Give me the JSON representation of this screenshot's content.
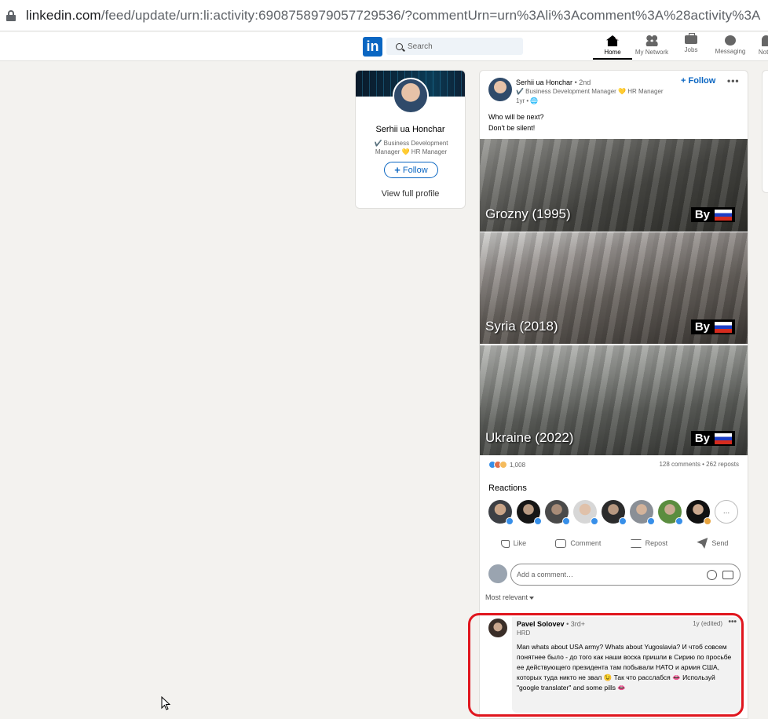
{
  "browser": {
    "url_host": "linkedin.com",
    "url_path": "/feed/update/urn:li:activity:6908758979057729536/?commentUrn=urn%3Ali%3Acomment%3A%28activity%3A"
  },
  "nav": {
    "logo": "in",
    "search_placeholder": "Search",
    "items": [
      {
        "label": "Home",
        "icon": "home-icon",
        "active": true
      },
      {
        "label": "My Network",
        "icon": "network-icon"
      },
      {
        "label": "Jobs",
        "icon": "jobs-icon"
      },
      {
        "label": "Messaging",
        "icon": "messaging-icon"
      },
      {
        "label": "Notifi",
        "icon": "notifications-icon"
      }
    ]
  },
  "profile_card": {
    "name": "Serhii ua Honchar",
    "title": "✔️ Business Development Manager 💛 HR Manager",
    "follow_label": "Follow",
    "view_profile_label": "View full profile"
  },
  "post": {
    "author": "Serhii ua Honchar",
    "degree": "• 2nd",
    "author_title": "✔️ Business Development Manager 💛 HR Manager",
    "time": "1yr •",
    "follow_label": "Follow",
    "text_line1": "Who will be next?",
    "text_line2": "Don't be silent!",
    "images": [
      {
        "label": "Grozny (1995)",
        "by": "By"
      },
      {
        "label": "Syria (2018)",
        "by": "By"
      },
      {
        "label": "Ukraine (2022)",
        "by": "By"
      }
    ],
    "reaction_count": "1,008",
    "comments_reposts": "128 comments • 262 reposts",
    "reactions_title": "Reactions",
    "reactors_more": "...",
    "actions": [
      {
        "label": "Like",
        "icon": "like-icon"
      },
      {
        "label": "Comment",
        "icon": "comment-icon"
      },
      {
        "label": "Repost",
        "icon": "repost-icon"
      },
      {
        "label": "Send",
        "icon": "send-icon"
      }
    ],
    "comment_placeholder": "Add a comment…",
    "sort_label": "Most relevant"
  },
  "reply": {
    "name": "Pavel Solovev",
    "degree": "• 3rd+",
    "headline": "HRD",
    "time": "1y (edited)",
    "text": "Man whats about USA army? Whats about Yugoslavia? И чтоб совсем понятнее было - до того как наши воска пришли в Сирию по просьбе ее действующего президента там побывали НАТО и армия США, которых туда никто не звал 😉 Так что расслабся 👄 Используй \"google translater\" and some pills 👄"
  },
  "colors": {
    "linkedin_blue": "#0a66c2",
    "background": "#f3f2ef",
    "highlight_red": "#e0161e"
  }
}
